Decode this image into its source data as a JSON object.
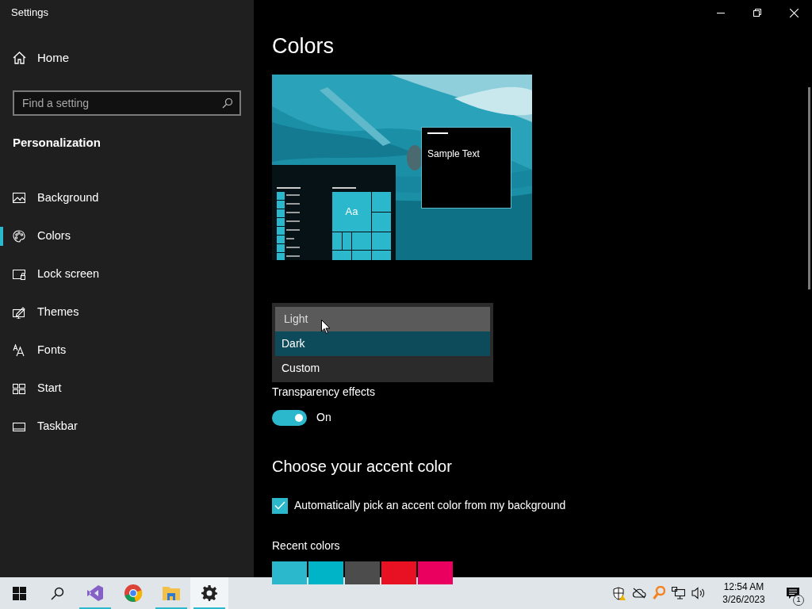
{
  "window": {
    "title": "Settings"
  },
  "sidebar": {
    "home": "Home",
    "search": {
      "placeholder": "Find a setting"
    },
    "section": "Personalization",
    "items": [
      {
        "kind": "background",
        "label": "Background",
        "selected": false
      },
      {
        "kind": "colors",
        "label": "Colors",
        "selected": true
      },
      {
        "kind": "lock",
        "label": "Lock screen",
        "selected": false
      },
      {
        "kind": "themes",
        "label": "Themes",
        "selected": false
      },
      {
        "kind": "fonts",
        "label": "Fonts",
        "selected": false
      },
      {
        "kind": "start",
        "label": "Start",
        "selected": false
      },
      {
        "kind": "taskbar",
        "label": "Taskbar",
        "selected": false
      }
    ]
  },
  "main": {
    "title": "Colors",
    "preview": {
      "tile_text": "Aa",
      "sample_text": "Sample Text"
    },
    "mode_dropdown": {
      "options": [
        {
          "label": "Light",
          "selected": false,
          "hovered": true
        },
        {
          "label": "Dark",
          "selected": true,
          "hovered": false
        },
        {
          "label": "Custom",
          "selected": false,
          "hovered": false
        }
      ]
    },
    "transparency": {
      "label": "Transparency effects",
      "on": true,
      "state_text": "On"
    },
    "accent_heading": "Choose your accent color",
    "auto_accent": {
      "label": "Automatically pick an accent color from my background",
      "checked": true
    },
    "recent_colors": {
      "label": "Recent colors",
      "colors": [
        {
          "color": "#2bb7cc"
        },
        {
          "color": "#00b4c8"
        },
        {
          "color": "#4c4c4c"
        },
        {
          "color": "#e81123"
        },
        {
          "color": "#ea005e"
        }
      ]
    }
  },
  "taskbar": {
    "apps": [
      {
        "kind": "start",
        "running": false,
        "active": false
      },
      {
        "kind": "search",
        "running": false,
        "active": false
      },
      {
        "kind": "studio",
        "running": true,
        "active": false
      },
      {
        "kind": "browser",
        "running": false,
        "active": false
      },
      {
        "kind": "folder",
        "running": true,
        "active": false
      },
      {
        "kind": "gear",
        "running": true,
        "active": true
      }
    ],
    "tray": [
      {
        "kind": "shield"
      },
      {
        "kind": "cloud"
      },
      {
        "kind": "key"
      },
      {
        "kind": "network"
      },
      {
        "kind": "volume"
      }
    ],
    "time": "12:54 AM",
    "date": "3/26/2023",
    "notifications": "1"
  }
}
